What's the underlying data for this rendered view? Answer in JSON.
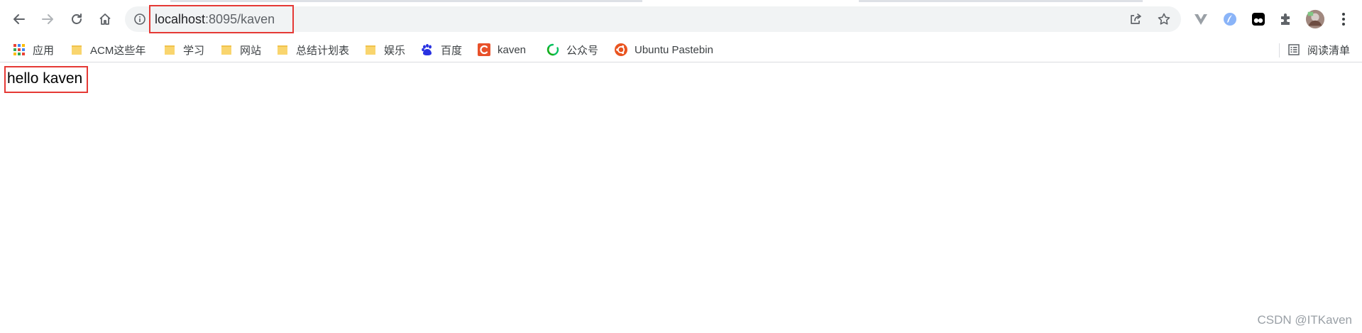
{
  "toolbar": {
    "back_icon": "arrow-left-icon",
    "forward_icon": "arrow-right-icon",
    "reload_icon": "reload-icon",
    "home_icon": "home-icon"
  },
  "omnibox": {
    "info_icon": "info-circle-icon",
    "url_host": "localhost",
    "url_rest": ":8095/kaven",
    "share_icon": "share-icon",
    "bookmark_icon": "star-icon"
  },
  "extensions": [
    {
      "name": "vue-devtools-icon",
      "color": "#9aa0a6"
    },
    {
      "name": "feather-extension-icon",
      "color": "#5b8fd9"
    },
    {
      "name": "tampermonkey-icon",
      "color": "#000000"
    },
    {
      "name": "puzzle-extensions-icon",
      "color": "#5f6368"
    },
    {
      "name": "profile-avatar",
      "color": "#8d6e63"
    },
    {
      "name": "menu-kebab-icon",
      "color": "#5f6368"
    }
  ],
  "bookmarks": [
    {
      "label": "应用",
      "icon": "apps-grid-icon"
    },
    {
      "label": "ACM这些年",
      "icon": "folder-icon"
    },
    {
      "label": "学习",
      "icon": "folder-icon"
    },
    {
      "label": "网站",
      "icon": "folder-icon"
    },
    {
      "label": "总结计划表",
      "icon": "folder-icon"
    },
    {
      "label": "娱乐",
      "icon": "folder-icon"
    },
    {
      "label": "百度",
      "icon": "baidu-paw-icon"
    },
    {
      "label": "kaven",
      "icon": "csdn-c-icon"
    },
    {
      "label": "公众号",
      "icon": "wechat-mp-icon"
    },
    {
      "label": "Ubuntu Pastebin",
      "icon": "ubuntu-icon"
    }
  ],
  "reading_list": {
    "label": "阅读清单",
    "icon": "reading-list-icon"
  },
  "page": {
    "body_text": "hello kaven",
    "watermark": "CSDN @ITKaven"
  },
  "colors": {
    "highlight": "#e53935",
    "omnibox_bg": "#f1f3f4",
    "folder": "#f9d56e",
    "csdn": "#e8512a",
    "ubuntu": "#e95420",
    "baidu": "#2932e1"
  }
}
